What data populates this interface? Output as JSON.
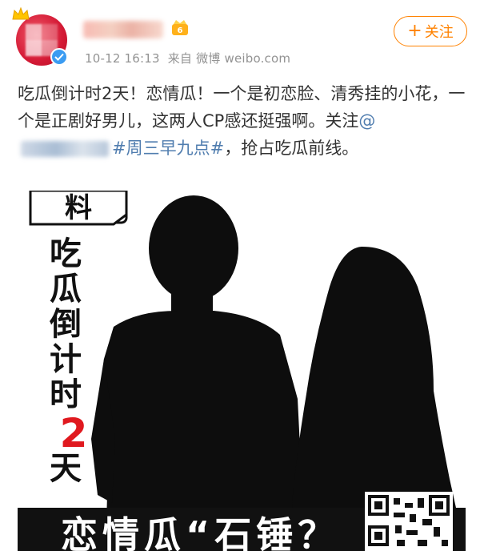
{
  "post": {
    "username_blurred": true,
    "timestamp": "10-12 16:13",
    "source": "来自 微博 weibo.com",
    "follow_label": "关注",
    "follow_plus": "+",
    "text_part1": "吃瓜倒计时2天！恋情瓜！一个是初恋脸、清秀挂的小花，一个是正剧好男儿，这两人CP感还挺强啊。关注",
    "mention_prefix": "@",
    "hashtag": "#周三早九点#",
    "text_part2": "，抢占吃瓜前线。"
  },
  "poster": {
    "vertical_text": [
      "吃",
      "瓜",
      "倒",
      "计",
      "时"
    ],
    "countdown_number": "2",
    "countdown_unit": "天",
    "bottom_banner": "恋情瓜“石锤？",
    "logo_text": "料",
    "colors": {
      "silhouette": "#0d0d0d",
      "accent_red": "#e0191f",
      "banner_bg": "#111111",
      "banner_text": "#ffffff"
    }
  },
  "colors": {
    "accent_orange": "#ff8200",
    "link_blue": "#507daf",
    "meta_gray": "#939393",
    "verified_blue": "#3b9cf2"
  },
  "icons": {
    "verified": "verified-badge-icon",
    "crown": "crown-icon",
    "vip": "vip-badge-icon",
    "qr": "qr-code-icon"
  }
}
